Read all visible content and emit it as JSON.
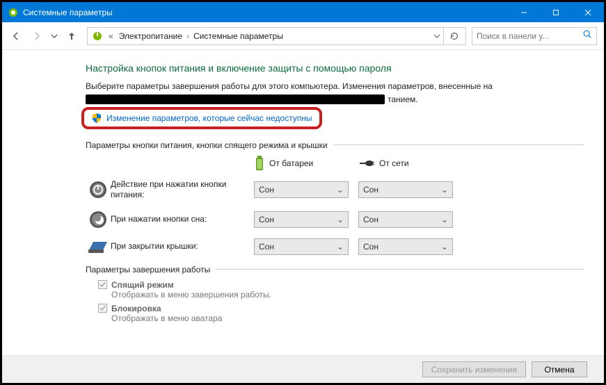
{
  "window": {
    "title": "Системные параметры"
  },
  "breadcrumb": {
    "lead": "«",
    "a": "Электропитание",
    "b": "Системные параметры"
  },
  "search": {
    "placeholder": "Поиск в панели у..."
  },
  "page_title": "Настройка кнопок питания и включение защиты с помощью пароля",
  "intro_line1": "Выберите параметры завершения работы для этого компьютера. Изменения параметров, внесенные на",
  "intro_line2_tail": "танием.",
  "change_link": "Изменение параметров, которые сейчас недоступны",
  "section_buttons": "Параметры кнопки питания, кнопки спящего режима и крышки",
  "cols": {
    "battery": "От батареи",
    "ac": "От сети"
  },
  "rows": {
    "power": {
      "label": "Действие при нажатии кнопки питания:",
      "battery": "Сон",
      "ac": "Сон"
    },
    "sleep": {
      "label": "При нажатии кнопки сна:",
      "battery": "Сон",
      "ac": "Сон"
    },
    "lid": {
      "label": "При закрытии крышки:",
      "battery": "Сон",
      "ac": "Сон"
    }
  },
  "section_shutdown": "Параметры завершения работы",
  "chk_sleep": {
    "label": "Спящий режим",
    "desc": "Отображать в меню завершения работы."
  },
  "chk_lock": {
    "label": "Блокировка",
    "desc": "Отображать в меню аватара"
  },
  "footer": {
    "save": "Сохранить изменения",
    "cancel": "Отмена"
  }
}
